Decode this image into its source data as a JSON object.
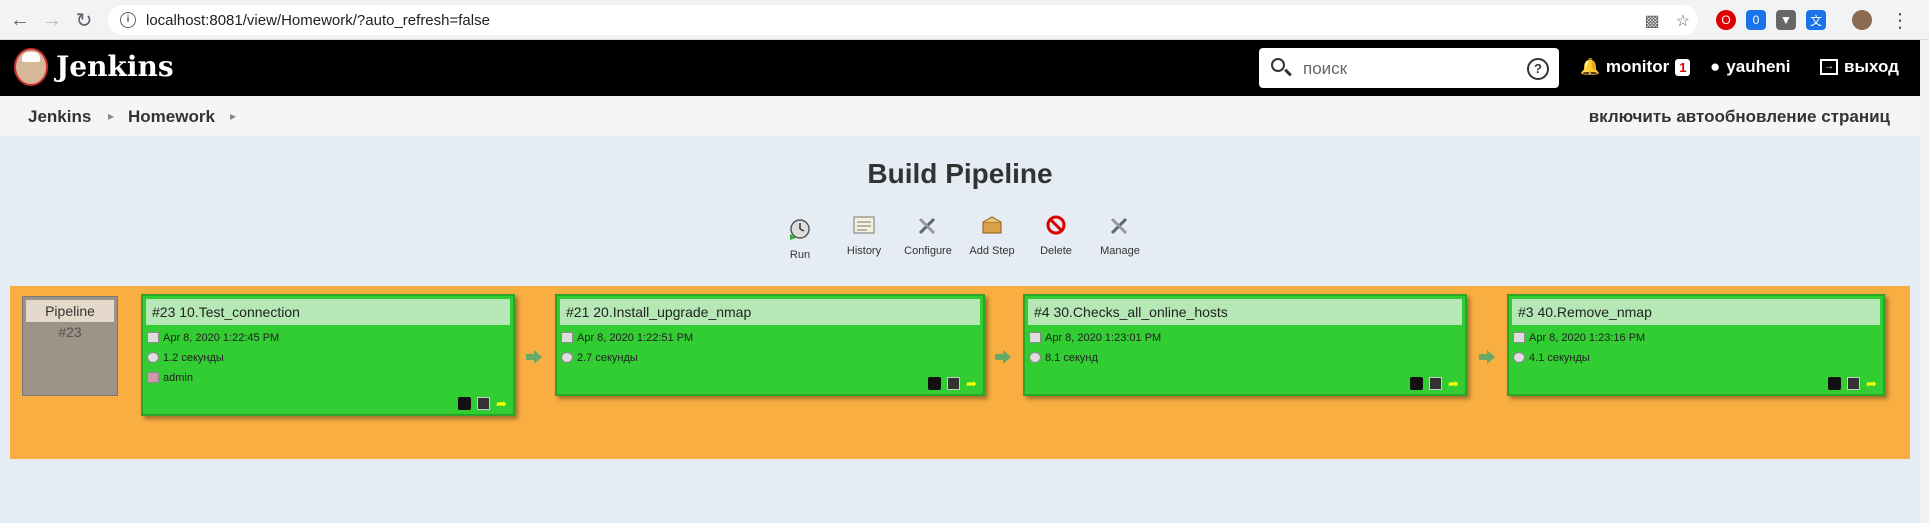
{
  "browser": {
    "url": "localhost:8081/view/Homework/?auto_refresh=false"
  },
  "header": {
    "brand": "Jenkins",
    "search_placeholder": "поиск",
    "monitor_label": "monitor",
    "monitor_count": "1",
    "user": "yauheni",
    "logout": "выход"
  },
  "breadcrumb": {
    "items": [
      "Jenkins",
      "Homework"
    ],
    "auto_refresh": "включить автообновление страниц"
  },
  "main": {
    "title": "Build Pipeline",
    "toolbar": [
      "Run",
      "History",
      "Configure",
      "Add Step",
      "Delete",
      "Manage"
    ]
  },
  "pipeline": {
    "label": "Pipeline",
    "number": "#23",
    "stages": [
      {
        "title": "#23 10.Test_connection",
        "date": "Apr 8, 2020 1:22:45 PM",
        "duration": "1.2 секунды",
        "user": "admin"
      },
      {
        "title": "#21 20.Install_upgrade_nmap",
        "date": "Apr 8, 2020 1:22:51 PM",
        "duration": "2.7 секунды"
      },
      {
        "title": "#4 30.Checks_all_online_hosts",
        "date": "Apr 8, 2020 1:23:01 PM",
        "duration": "8.1 секунд"
      },
      {
        "title": "#3 40.Remove_nmap",
        "date": "Apr 8, 2020 1:23:16 PM",
        "duration": "4.1 секунды"
      }
    ]
  },
  "colors": {
    "band": "#f9ae41",
    "stage_success": "#32cd32",
    "stage_header": "#b6e8b6"
  }
}
